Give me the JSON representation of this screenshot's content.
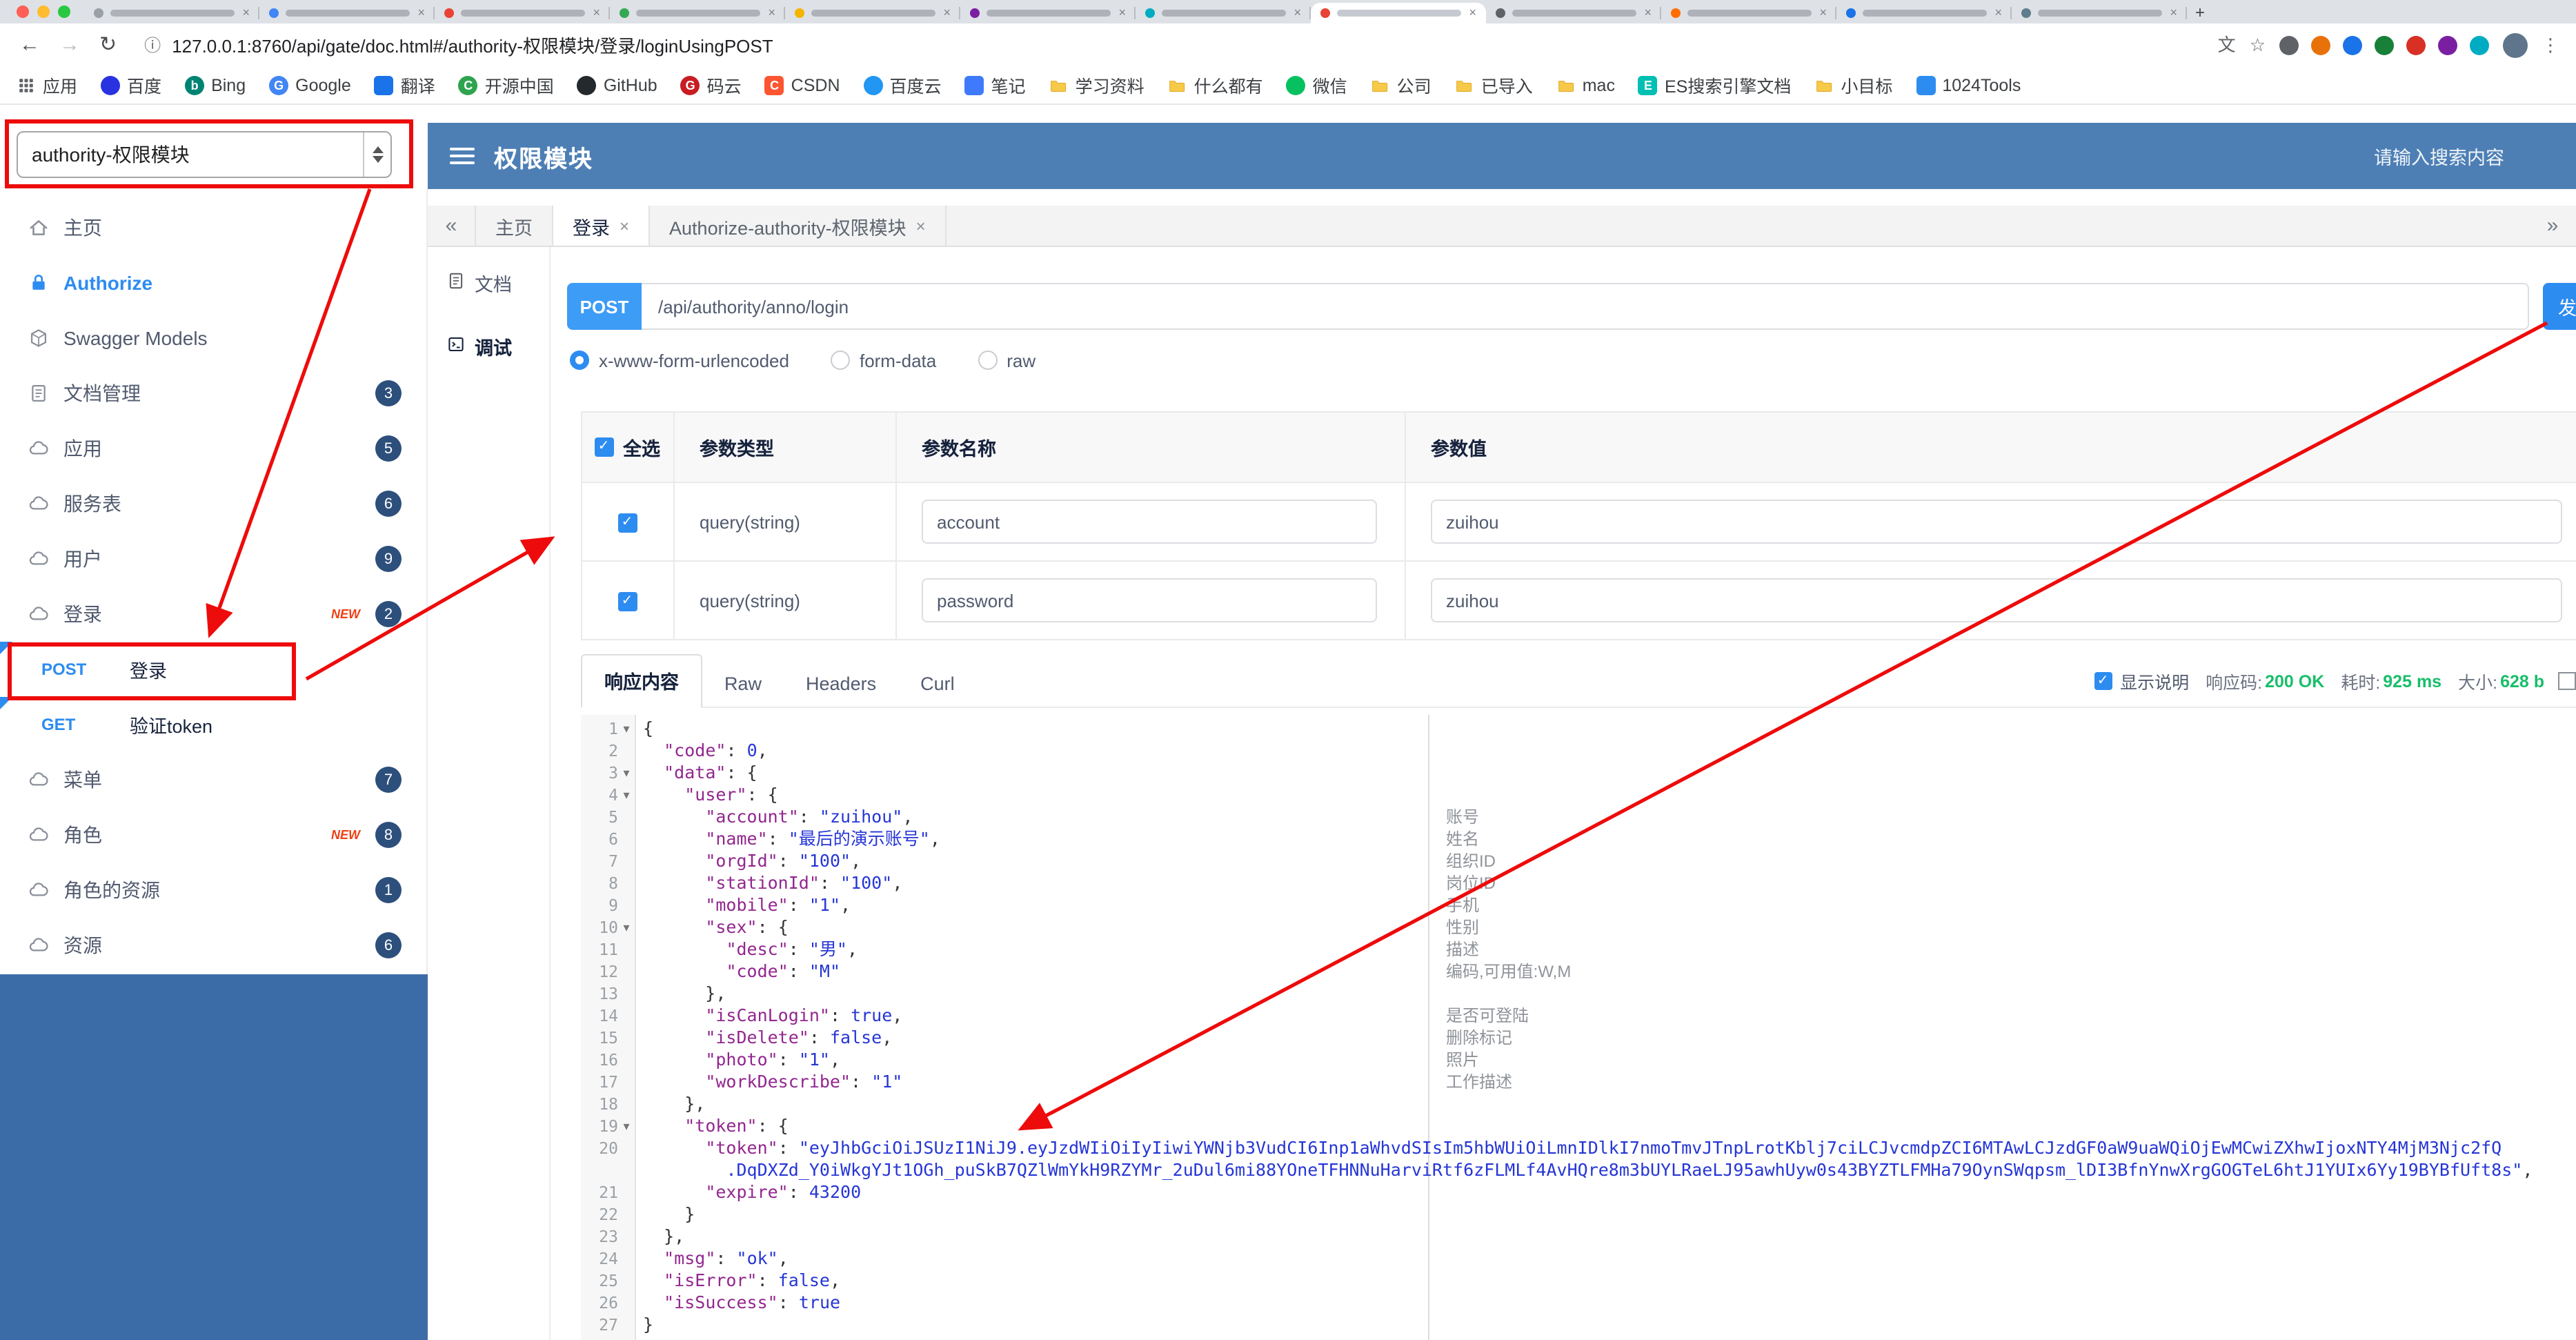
{
  "glyphs": {
    "close": "×",
    "back": "←",
    "forward": "→",
    "reload": "↻",
    "info": "ⓘ",
    "star": "☆",
    "dots": "⋮",
    "plus": "+",
    "check": "✓",
    "fold": "▾",
    "chev_left": "«",
    "chev_right": "»",
    "translate": "文"
  },
  "browser": {
    "traffic_lights": [
      "#ff5f57",
      "#febc2e",
      "#28c840"
    ],
    "active_tab_index": 7,
    "tabs": [
      {
        "favicon": "#9aa0a6"
      },
      {
        "favicon": "#4285f4"
      },
      {
        "favicon": "#e94335"
      },
      {
        "favicon": "#34a853"
      },
      {
        "favicon": "#f4b400"
      },
      {
        "favicon": "#7b1fa2"
      },
      {
        "favicon": "#00acc1"
      },
      {
        "favicon": "#e94335"
      },
      {
        "favicon": "#5f6368"
      },
      {
        "favicon": "#ff6d00"
      },
      {
        "favicon": "#1a73e8"
      },
      {
        "favicon": "#607d8b"
      }
    ],
    "url": "127.0.0.1:8760/api/gate/doc.html#/authority-权限模块/登录/loginUsingPOST",
    "extension_icon_colors": [
      "#5f6368",
      "#e8710a",
      "#1a73e8",
      "#188038",
      "#d93025",
      "#7b1fa2",
      "#00acc1"
    ],
    "bookmarks": [
      {
        "label": "应用",
        "icon": "grid"
      },
      {
        "label": "百度",
        "icon": "dot",
        "color": "#2932e1"
      },
      {
        "label": "Bing",
        "icon": "dot",
        "color": "#008373",
        "letter": "b"
      },
      {
        "label": "Google",
        "icon": "dot",
        "color": "#4285f4",
        "letter": "G"
      },
      {
        "label": "翻译",
        "icon": "square",
        "color": "#1a73e8"
      },
      {
        "label": "开源中国",
        "icon": "dot",
        "color": "#2ea44f",
        "letter": "C"
      },
      {
        "label": "GitHub",
        "icon": "dot",
        "color": "#24292e"
      },
      {
        "label": "码云",
        "icon": "dot",
        "color": "#c71d23",
        "letter": "G"
      },
      {
        "label": "CSDN",
        "icon": "square",
        "color": "#fc5531",
        "letter": "C"
      },
      {
        "label": "百度云",
        "icon": "dot",
        "color": "#2196f3"
      },
      {
        "label": "笔记",
        "icon": "square",
        "color": "#3f7afc"
      },
      {
        "label": "学习资料",
        "icon": "folder"
      },
      {
        "label": "什么都有",
        "icon": "folder"
      },
      {
        "label": "微信",
        "icon": "dot",
        "color": "#07c160"
      },
      {
        "label": "公司",
        "icon": "folder"
      },
      {
        "label": "已导入",
        "icon": "folder"
      },
      {
        "label": "mac",
        "icon": "folder"
      },
      {
        "label": "ES搜索引擎文档",
        "icon": "square",
        "color": "#00bfb3",
        "letter": "E"
      },
      {
        "label": "小目标",
        "icon": "folder"
      },
      {
        "label": "1024Tools",
        "icon": "square",
        "color": "#2d8cf0"
      }
    ]
  },
  "header": {
    "service_select": "authority-权限模块",
    "title": "权限模块",
    "search_placeholder": "请输入搜索内容"
  },
  "sidebar": {
    "new_badge_label": "NEW",
    "items": [
      {
        "label": "主页",
        "icon": "home"
      },
      {
        "label": "Authorize",
        "icon": "lock",
        "accent": true
      },
      {
        "label": "Swagger Models",
        "icon": "models"
      },
      {
        "label": "文档管理",
        "icon": "docs",
        "badge": "3"
      },
      {
        "label": "应用",
        "icon": "cloud",
        "badge": "5"
      },
      {
        "label": "服务表",
        "icon": "cloud",
        "badge": "6"
      },
      {
        "label": "用户",
        "icon": "cloud",
        "badge": "9"
      },
      {
        "label": "登录",
        "icon": "cloud",
        "badge": "2",
        "new": true
      },
      {
        "label": "登录",
        "method": "POST",
        "selected": true
      },
      {
        "label": "验证token",
        "method": "GET"
      },
      {
        "label": "菜单",
        "icon": "cloud",
        "badge": "7"
      },
      {
        "label": "角色",
        "icon": "cloud",
        "badge": "8",
        "new": true
      },
      {
        "label": "角色的资源",
        "icon": "cloud",
        "badge": "1"
      },
      {
        "label": "资源",
        "icon": "cloud",
        "badge": "6"
      }
    ]
  },
  "doc_tabs": [
    {
      "label": "主页"
    },
    {
      "label": "登录",
      "closable": true,
      "active": true
    },
    {
      "label": "Authorize-authority-权限模块",
      "closable": true
    }
  ],
  "side_tabs": [
    {
      "label": "文档",
      "icon": "file"
    },
    {
      "label": "调试",
      "icon": "debug",
      "active": true
    }
  ],
  "request": {
    "method": "POST",
    "url": "/api/authority/anno/login",
    "send_label": "发送",
    "content_types": [
      {
        "label": "x-www-form-urlencoded",
        "selected": true
      },
      {
        "label": "form-data"
      },
      {
        "label": "raw"
      }
    ],
    "params_table": {
      "headers": [
        "全选",
        "参数类型",
        "参数名称",
        "参数值"
      ],
      "rows": [
        {
          "checked": true,
          "type": "query(string)",
          "name": "account",
          "value": "zuihou"
        },
        {
          "checked": true,
          "type": "query(string)",
          "name": "password",
          "value": "zuihou"
        }
      ]
    }
  },
  "response": {
    "tabs": [
      {
        "label": "响应内容",
        "active": true
      },
      {
        "label": "Raw"
      },
      {
        "label": "Headers"
      },
      {
        "label": "Curl"
      }
    ],
    "meta": {
      "desc_label": "显示说明",
      "code_label": "响应码:",
      "code": "200 OK",
      "time_label": "耗时:",
      "time": "925 ms",
      "size_label": "大小:",
      "size": "628 b"
    },
    "annotations": [
      {
        "line": 5,
        "text": "账号"
      },
      {
        "line": 6,
        "text": "姓名"
      },
      {
        "line": 7,
        "text": "组织ID"
      },
      {
        "line": 8,
        "text": "岗位ID"
      },
      {
        "line": 9,
        "text": "手机"
      },
      {
        "line": 10,
        "text": "性别"
      },
      {
        "line": 11,
        "text": "描述"
      },
      {
        "line": 12,
        "text": "编码,可用值:W,M"
      },
      {
        "line": 14,
        "text": "是否可登陆"
      },
      {
        "line": 15,
        "text": "删除标记"
      },
      {
        "line": 16,
        "text": "照片"
      },
      {
        "line": 17,
        "text": "工作描述"
      }
    ],
    "code_lines": [
      {
        "n": "1",
        "fold": true,
        "t": [
          [
            "pun",
            "{"
          ]
        ]
      },
      {
        "n": "2",
        "t": [
          [
            "pun",
            "  "
          ],
          [
            "key",
            "\"code\""
          ],
          [
            "pun",
            ": "
          ],
          [
            "num",
            "0"
          ],
          [
            "pun",
            ","
          ]
        ]
      },
      {
        "n": "3",
        "fold": true,
        "t": [
          [
            "pun",
            "  "
          ],
          [
            "key",
            "\"data\""
          ],
          [
            "pun",
            ": {"
          ]
        ]
      },
      {
        "n": "4",
        "fold": true,
        "t": [
          [
            "pun",
            "    "
          ],
          [
            "key",
            "\"user\""
          ],
          [
            "pun",
            ": {"
          ]
        ]
      },
      {
        "n": "5",
        "t": [
          [
            "pun",
            "      "
          ],
          [
            "key",
            "\"account\""
          ],
          [
            "pun",
            ": "
          ],
          [
            "str",
            "\"zuihou\""
          ],
          [
            "pun",
            ","
          ]
        ]
      },
      {
        "n": "6",
        "t": [
          [
            "pun",
            "      "
          ],
          [
            "key",
            "\"name\""
          ],
          [
            "pun",
            ": "
          ],
          [
            "str",
            "\"最后的演示账号\""
          ],
          [
            "pun",
            ","
          ]
        ]
      },
      {
        "n": "7",
        "t": [
          [
            "pun",
            "      "
          ],
          [
            "key",
            "\"orgId\""
          ],
          [
            "pun",
            ": "
          ],
          [
            "str",
            "\"100\""
          ],
          [
            "pun",
            ","
          ]
        ]
      },
      {
        "n": "8",
        "t": [
          [
            "pun",
            "      "
          ],
          [
            "key",
            "\"stationId\""
          ],
          [
            "pun",
            ": "
          ],
          [
            "str",
            "\"100\""
          ],
          [
            "pun",
            ","
          ]
        ]
      },
      {
        "n": "9",
        "t": [
          [
            "pun",
            "      "
          ],
          [
            "key",
            "\"mobile\""
          ],
          [
            "pun",
            ": "
          ],
          [
            "str",
            "\"1\""
          ],
          [
            "pun",
            ","
          ]
        ]
      },
      {
        "n": "10",
        "fold": true,
        "t": [
          [
            "pun",
            "      "
          ],
          [
            "key",
            "\"sex\""
          ],
          [
            "pun",
            ": {"
          ]
        ]
      },
      {
        "n": "11",
        "t": [
          [
            "pun",
            "        "
          ],
          [
            "key",
            "\"desc\""
          ],
          [
            "pun",
            ": "
          ],
          [
            "str",
            "\"男\""
          ],
          [
            "pun",
            ","
          ]
        ]
      },
      {
        "n": "12",
        "t": [
          [
            "pun",
            "        "
          ],
          [
            "key",
            "\"code\""
          ],
          [
            "pun",
            ": "
          ],
          [
            "str",
            "\"M\""
          ]
        ]
      },
      {
        "n": "13",
        "t": [
          [
            "pun",
            "      },"
          ]
        ]
      },
      {
        "n": "14",
        "t": [
          [
            "pun",
            "      "
          ],
          [
            "key",
            "\"isCanLogin\""
          ],
          [
            "pun",
            ": "
          ],
          [
            "bool",
            "true"
          ],
          [
            "pun",
            ","
          ]
        ]
      },
      {
        "n": "15",
        "t": [
          [
            "pun",
            "      "
          ],
          [
            "key",
            "\"isDelete\""
          ],
          [
            "pun",
            ": "
          ],
          [
            "bool",
            "false"
          ],
          [
            "pun",
            ","
          ]
        ]
      },
      {
        "n": "16",
        "t": [
          [
            "pun",
            "      "
          ],
          [
            "key",
            "\"photo\""
          ],
          [
            "pun",
            ": "
          ],
          [
            "str",
            "\"1\""
          ],
          [
            "pun",
            ","
          ]
        ]
      },
      {
        "n": "17",
        "t": [
          [
            "pun",
            "      "
          ],
          [
            "key",
            "\"workDescribe\""
          ],
          [
            "pun",
            ": "
          ],
          [
            "str",
            "\"1\""
          ]
        ]
      },
      {
        "n": "18",
        "t": [
          [
            "pun",
            "    },"
          ]
        ]
      },
      {
        "n": "19",
        "fold": true,
        "t": [
          [
            "pun",
            "    "
          ],
          [
            "key",
            "\"token\""
          ],
          [
            "pun",
            ": {"
          ]
        ]
      },
      {
        "n": "20",
        "t": [
          [
            "pun",
            "      "
          ],
          [
            "key",
            "\"token\""
          ],
          [
            "pun",
            ": "
          ],
          [
            "str",
            "\"eyJhbGciOiJSUzI1NiJ9.eyJzdWIiOiIyIiwiYWNjb3VudCI6Inp1aWhvdSIsIm5hbWUiOiLmnIDlkI7nmoTmvJTnpLrotKblj7ciLCJvcmdpZCI6MTAwLCJzdGF0aW9uaWQiOjEwMCwiZXhwIjoxNTY4MjM3Njc2fQ"
          ]
        ]
      },
      {
        "n": "",
        "t": [
          [
            "pun",
            "        "
          ],
          [
            "str",
            ".DqDXZd_Y0iWkgYJt1OGh_puSkB7QZlWmYkH9RZYMr_2uDul6mi88YOneTFHNNuHarviRtf6zFLMLf4AvHQre8m3bUYLRaeLJ95awhUyw0s43BYZTLFMHa79OynSWqpsm_lDI3BfnYnwXrgGOGTeL6htJ1YUIx6Yy19BYBfUft8s\""
          ],
          [
            "pun",
            ","
          ]
        ]
      },
      {
        "n": "21",
        "t": [
          [
            "pun",
            "      "
          ],
          [
            "key",
            "\"expire\""
          ],
          [
            "pun",
            ": "
          ],
          [
            "num",
            "43200"
          ]
        ]
      },
      {
        "n": "22",
        "t": [
          [
            "pun",
            "    }"
          ]
        ]
      },
      {
        "n": "23",
        "t": [
          [
            "pun",
            "  },"
          ]
        ]
      },
      {
        "n": "24",
        "t": [
          [
            "pun",
            "  "
          ],
          [
            "key",
            "\"msg\""
          ],
          [
            "pun",
            ": "
          ],
          [
            "str",
            "\"ok\""
          ],
          [
            "pun",
            ","
          ]
        ]
      },
      {
        "n": "25",
        "t": [
          [
            "pun",
            "  "
          ],
          [
            "key",
            "\"isError\""
          ],
          [
            "pun",
            ": "
          ],
          [
            "bool",
            "false"
          ],
          [
            "pun",
            ","
          ]
        ]
      },
      {
        "n": "26",
        "t": [
          [
            "pun",
            "  "
          ],
          [
            "key",
            "\"isSuccess\""
          ],
          [
            "pun",
            ": "
          ],
          [
            "bool",
            "true"
          ]
        ]
      },
      {
        "n": "27",
        "t": [
          [
            "pun",
            "}"
          ]
        ]
      }
    ]
  }
}
